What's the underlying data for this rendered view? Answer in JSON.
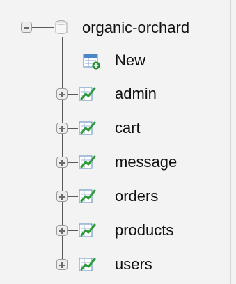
{
  "tree": {
    "database": {
      "label": "organic-orchard",
      "icon": "database-icon"
    },
    "new_item": {
      "label": "New",
      "icon": "new-table-icon"
    },
    "tables": [
      {
        "label": "admin"
      },
      {
        "label": "cart"
      },
      {
        "label": "message"
      },
      {
        "label": "orders"
      },
      {
        "label": "products"
      },
      {
        "label": "users"
      }
    ]
  },
  "colors": {
    "background": "#f3f3f3",
    "tree_line": "#5a5a5a",
    "icon_green": "#2f9a3a",
    "icon_blue": "#4b86c9"
  }
}
